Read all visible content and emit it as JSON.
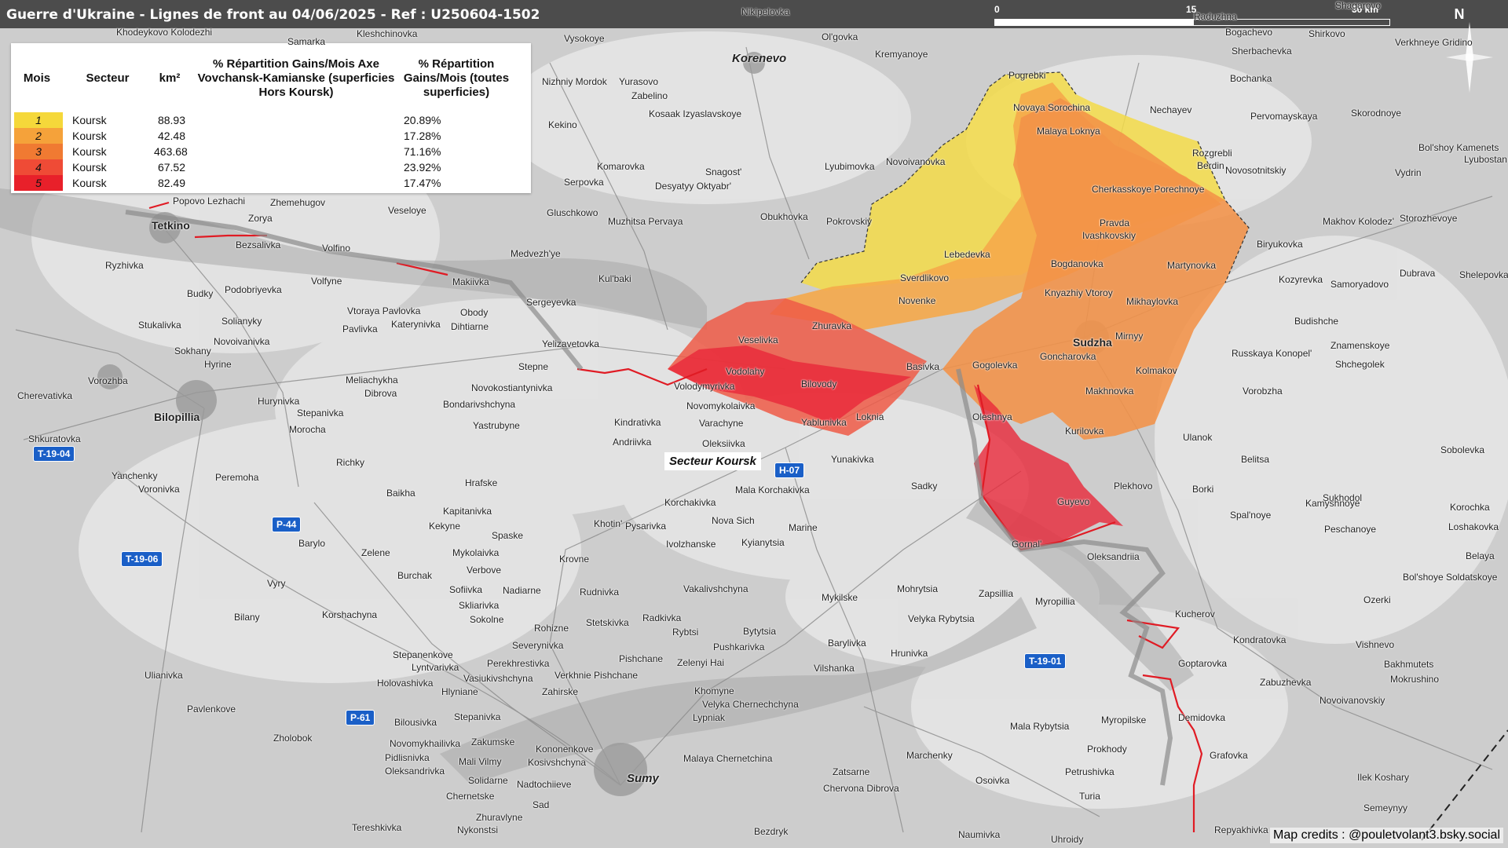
{
  "title": "Guerre d'Ukraine - Lignes de front au 04/06/2025 - Ref : U250604-1502",
  "scale": {
    "labels": [
      "0",
      "15",
      "30 km"
    ]
  },
  "north": "N",
  "legend": {
    "headers": {
      "mois": "Mois",
      "secteur": "Secteur",
      "km2": "km²",
      "pct_axe": "% Répartition Gains/Mois Axe Vovchansk-Kamianske (superficies Hors Koursk)",
      "pct_all": "% Répartition Gains/Mois (toutes superficies)"
    },
    "rows": [
      {
        "mois": "1",
        "secteur": "Koursk",
        "km2": "88.93",
        "pct_axe": "",
        "pct_all": "20.89%",
        "color": "#f5d83a"
      },
      {
        "mois": "2",
        "secteur": "Koursk",
        "km2": "42.48",
        "pct_axe": "",
        "pct_all": "17.28%",
        "color": "#f5a23a"
      },
      {
        "mois": "3",
        "secteur": "Koursk",
        "km2": "463.68",
        "pct_axe": "",
        "pct_all": "71.16%",
        "color": "#f07a32"
      },
      {
        "mois": "4",
        "secteur": "Koursk",
        "km2": "67.52",
        "pct_axe": "",
        "pct_all": "23.92%",
        "color": "#ef4b36"
      },
      {
        "mois": "5",
        "secteur": "Koursk",
        "km2": "82.49",
        "pct_axe": "",
        "pct_all": "17.47%",
        "color": "#e8202a"
      }
    ]
  },
  "sector_label": "Secteur Koursk",
  "credits": "Map credits : @pouletvolant3.bsky.social",
  "roads": [
    "T-19-04",
    "T-19-06",
    "P-44",
    "H-07",
    "P-61",
    "T-19-01"
  ],
  "places": {
    "tetkino": "Tetkino",
    "korenevo": "Korenevo",
    "sudzha": "Sudzha",
    "sumy": "Sumy",
    "bilopillia": "Bilopillia",
    "richky": "Richky",
    "yunakivka": "Yunakivka",
    "guyevo": "Guyevo",
    "gornal": "Gornal'",
    "oleksandriia": "Oleksandriia",
    "loknia": "Loknia",
    "basivka": "Basivka",
    "bilovody": "Bilovody",
    "volodymyrivka": "Volodymyrivka",
    "novomykolaivka": "Novomykolaivka",
    "vodolahy": "Vodolahy",
    "veselivka": "Veselivka",
    "zhuravka": "Zhuravka",
    "novenke": "Novenke",
    "gogolevka": "Gogolevka",
    "goncharovka": "Goncharovka",
    "makhnovka": "Makhnovka",
    "kurilovka": "Kurilovka",
    "mirnyy": "Mirnyy",
    "kolmakov": "Kolmakov",
    "oleshnya": "Oleshnya",
    "plekhovo": "Plekhovo",
    "kucherov": "Kucherov",
    "goptarovka": "Goptarovka",
    "demidovka": "Demidovka",
    "grafovka": "Grafovka",
    "myropilske": "Myropilske",
    "mykilske": "Mykilske",
    "khotin": "Khotin'",
    "stepne": "Stepne",
    "yablunivka": "Yablunivka",
    "kindrativka": "Kindrativka",
    "oleksiivka": "Oleksiivka",
    "varachyne": "Varachyne",
    "andriivka": "Andriivka",
    "sverdlikovo": "Sverdlikovo",
    "lebedevka": "Lebedevka",
    "bogdanovka": "Bogdanovka",
    "knyazhiy": "Knyazhiy Vtoroy",
    "martynovka": "Martynovka",
    "mikhaylovka": "Mikhaylovka",
    "pogrebki": "Pogrebki",
    "novaya_sorochina": "Novaya Sorochina",
    "malaya_loknya": "Malaya Loknya",
    "nechayev": "Nechayev",
    "rozgrebli": "Rozgrebli",
    "berdin": "Berdin",
    "cherkasskoye": "Cherkasskoye Porechnoye",
    "pravda": "Pravda",
    "ivashkovskiy": "Ivashkovskiy",
    "lyubimovka": "Lyubimovka",
    "novoivanovka": "Novoivanovka",
    "pokrovskiy": "Pokrovskiy",
    "obukhovka": "Obukhovka",
    "snagost": "Snagost'",
    "komarovka": "Komarovka",
    "kekino": "Kekino",
    "serpovka": "Serpovka",
    "desyatyy": "Desyatyy Oktyabr'",
    "gluschkowo": "Gluschkowo",
    "muzhitsa": "Muzhitsa Pervaya",
    "kulbaki": "Kul'baki",
    "sergeyevka": "Sergeyevka",
    "yelizavetovka": "Yelizavetovka",
    "medvezhye": "Medvezh'ye",
    "makiivka": "Makiivka",
    "volfino": "Volfino",
    "zorya": "Zorya",
    "ryzhivka": "Ryzhivka",
    "budky": "Budky",
    "stukalivka": "Stukalivka",
    "sokhany": "Sokhany",
    "hyrine": "Hyrine",
    "vorozhba": "Vorozhba",
    "cherevativka": "Cherevativka",
    "shkuratovka": "Shkuratovka",
    "yanchenky": "Yanchenky",
    "voronivka": "Voronivka",
    "peremoha": "Peremoha",
    "baikha": "Baikha",
    "hrafske": "Hrafske",
    "kapitanivka": "Kapitanivka",
    "kekyne": "Kekyne",
    "spaske": "Spaske",
    "mykolaivka": "Mykolaivka",
    "korchakivka": "Korchakivka",
    "mala_korchakivka": "Mala Korchakivka",
    "nova_sich": "Nova Sich",
    "pysarivka": "Pysarivka",
    "ivolzhanske": "Ivolzhanske",
    "kyianytsia": "Kyianytsia",
    "marine": "Marine",
    "sadky": "Sadky",
    "krovne": "Krovne",
    "vakalivshchyna": "Vakalivshchyna",
    "mohrytsia": "Mohrytsia",
    "zapsillia": "Zapsillia",
    "myropillia": "Myropillia",
    "barylivka": "Barylivka",
    "hrunivka": "Hrunivka",
    "vilshanka": "Vilshanka",
    "khomyne": "Khomyne",
    "lypniak": "Lypniak",
    "velyka_chernechchyna": "Velyka Chernechchyna",
    "malaya_chernetchina": "Malaya Chernetchina",
    "zatsarne": "Zatsarne",
    "chervona_dibrova": "Chervona Dibrova",
    "osoivka": "Osoivka",
    "turia": "Turia",
    "prokhody": "Prokhody",
    "petrushivka": "Petrushivka",
    "naumivka": "Naumivka",
    "uhroidy": "Uhroidy",
    "repyakhivka": "Repyakhivka",
    "bezdryk": "Bezdryk",
    "sad": "Sad",
    "nykonstsi": "Nykonstsi",
    "tereshkivka": "Tereshkivka",
    "chernetske": "Chernetske",
    "ulanok": "Ulanok",
    "borki": "Borki",
    "belitsa": "Belitsa",
    "spalnoye": "Spal'noye",
    "sukhodol": "Sukhodol",
    "kamyshnoye": "Kamyshnoye",
    "peschanoye": "Peschanoye",
    "korochka": "Korochka",
    "loshakovka": "Loshakovka",
    "kondratovka": "Kondratovka",
    "zabuzhevka": "Zabuzhevka",
    "novoivanovskiy": "Novoivanovskiy",
    "vishnevo": "Vishnevo",
    "bakhmutets": "Bakhmutets",
    "mokrushino": "Mokrushino",
    "ozerki": "Ozerki",
    "belaya": "Belaya",
    "znamenskoye": "Znamenskoye",
    "shchegolek": "Shchegolek",
    "vorobzha": "Vorobzha",
    "budishche": "Budishche",
    "kozyrevka": "Kozyrevka",
    "samoryadovo": "Samoryadovo",
    "dubrava": "Dubrava",
    "shelepovka": "Shelepovka",
    "biryukovka": "Biryukovka",
    "makhov_kolodez": "Makhov Kolodez'",
    "storozhevoye": "Storozhevoye",
    "vydrin": "Vydrin",
    "bolshoye_kamenets": "Bol'shoy Kamenets",
    "skorodnoye": "Skorodnoye",
    "shirkovo": "Shirkovo",
    "sherbachevka": "Sherbachevka",
    "bochanka": "Bochanka",
    "pervomayskaya": "Pervomayskaya",
    "novosotnitskiy": "Novosotnitskiy",
    "russkaya_konopel": "Russkaya Konopel'",
    "zelenyi_hai": "Zelenyi Hai",
    "pushkarivka": "Pushkarivka",
    "velyka_rybytsia": "Velyka Rybytsia",
    "mala_rybytsia": "Mala Rybytsia",
    "marchenky": "Marchenky",
    "rybtsi": "Rybtsi",
    "bytytsia": "Bytytsia",
    "stetskivka": "Stetskivka",
    "radkivka": "Radkivka",
    "rudnivka": "Rudnivka",
    "nadiarne": "Nadiarne",
    "sokolne": "Sokolne",
    "burchak": "Burchak",
    "sofiivka": "Sofiivka",
    "bilani": "Bilany",
    "korshachyna": "Korshachyna",
    "zelene": "Zelene",
    "barylo": "Barylo",
    "vyry": "Vyry",
    "ulianivka": "Ulianivka",
    "pavlenkove": "Pavlenkove",
    "zholobok": "Zholobok",
    "bilousivka": "Bilousivka",
    "stepanivka": "Stepanivka",
    "novomykhailivka": "Novomykhailivka",
    "oleksandrivka": "Oleksandrivka",
    "pidlisnivka": "Pidlisnivka",
    "zakumske": "Zakumske",
    "mali_vilmy": "Mali Vilmy",
    "kosivshchyna": "Kosivshchyna",
    "nadtochiieve": "Nadtochiieve",
    "solidarne": "Solidarne",
    "zhuravlyne": "Zhuravlyne",
    "perekhrestivka": "Perekhrestivka",
    "stepanenkove": "Stepanenkove",
    "lyntvarivka": "Lyntvarivka",
    "holovashivka": "Holovashivka",
    "hlyniane": "Hlyniane",
    "vasiukivshchyna": "Vasiukivshchyna",
    "zahirske": "Zahirske",
    "verkhnie_pishchane": "Verkhnie Pishchane",
    "pishchane": "Pishchane",
    "kononenkove": "Kononenkove",
    "severynivka": "Severynivka",
    "rohizne": "Rohizne",
    "verbove": "Verbove",
    "skliarivka": "Skliarivka",
    "dihtiarne": "Dihtiarne",
    "obody": "Obody",
    "katerynivka": "Katerynivka",
    "vtoraya_pavlovka": "Vtoraya Pavlovka",
    "pavlivka": "Pavlivka",
    "solianyky": "Solianyky",
    "novoivanivka": "Novoivanivka",
    "podobriyevka": "Podobriyevka",
    "volfyne": "Volfyne",
    "bezsalivka": "Bezsalivka",
    "zhemehugov": "Zhemehugov",
    "popovo_lezhachi": "Popovo Lezhachi",
    "veseloye": "Veseloye",
    "meliachykha": "Meliachykha",
    "dibrova": "Dibrova",
    "hurynivka": "Hurynivka",
    "stepanivka2": "Stepanivka",
    "morocha": "Morocha",
    "yastrubyne": "Yastrubyne",
    "bondarivshchyna": "Bondarivshchyna",
    "novokostiantynivka": "Novokostiantynivka",
    "nikipelovka": "Nikipelovka",
    "olgovka": "Ol'govka",
    "kremyanoye": "Kremyanoye",
    "yurasovo": "Yurasovo",
    "zabelino": "Zabelino",
    "nizhniy_mordok": "Nizhniy Mordok",
    "kosaak": "Kosaak Izyaslavskoye",
    "vysokoye": "Vysokoye",
    "khodeykovo": "Khodeykovo Kolodezhi",
    "samarka": "Samarka",
    "kleshchinovka": "Kleshchinovka",
    "bolshoye_soldatskoye": "Bol'shoye Soldatskoye",
    "sobolevka": "Sobolevka",
    "ilek": "Ilek Koshary",
    "semeynyy": "Semeynyy",
    "verkhneye_gridino": "Verkhneye Gridino",
    "lyubostan": "Lyubostan",
    "raduzhna": "Raduzhna",
    "shagarovo": "Shagarovo",
    "bogachevo": "Bogachevo"
  }
}
